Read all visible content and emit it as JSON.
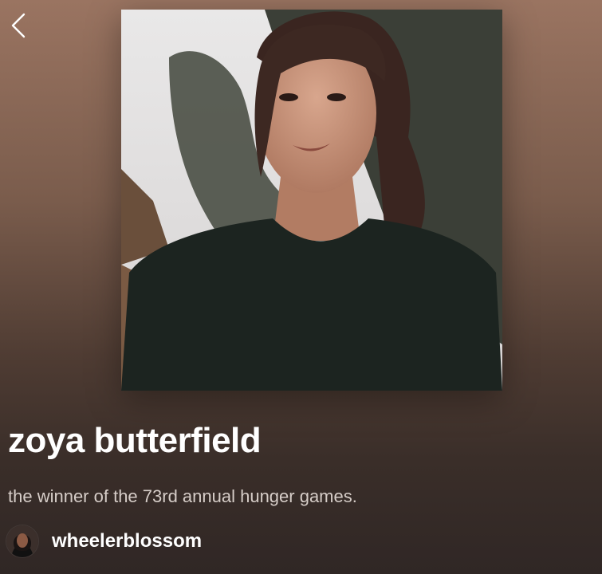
{
  "header": {
    "back_icon": "chevron-left-icon"
  },
  "playlist": {
    "title": "zoya butterfield",
    "description": "the winner of the 73rd annual hunger games.",
    "cover_image": "portrait-photo"
  },
  "owner": {
    "name": "wheelerblossom",
    "avatar": "user-avatar"
  },
  "colors": {
    "background_top": "#9a7461",
    "background_bottom": "#302725",
    "title_text": "#ffffff",
    "description_text": "#d6cdc8"
  }
}
